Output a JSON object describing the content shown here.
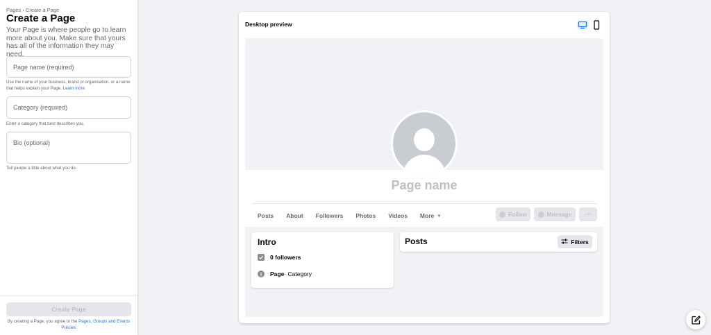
{
  "sidebar": {
    "breadcrumb": {
      "root": "Pages",
      "separator": "›",
      "current": "Create a Page"
    },
    "title": "Create a Page",
    "intro": "Your Page is where people go to learn more about you. Make sure that yours has all of the information they may need.",
    "fields": {
      "name": {
        "placeholder": "Page name (required)",
        "help": "Use the name of your business, brand or organisation, or a name that helps explain your Page.",
        "help_link": "Learn more"
      },
      "category": {
        "placeholder": "Category (required)",
        "help": "Enter a category that best describes you."
      },
      "bio": {
        "placeholder": "Bio (optional)",
        "help": "Tell people a little about what you do."
      }
    },
    "footer": {
      "create_label": "Create Page",
      "terms_prefix": "By creating a Page, you agree to the",
      "terms_link": "Pages, Groups and Events Policies"
    }
  },
  "preview": {
    "title": "Desktop preview",
    "page_name": "Page name",
    "tabs": [
      {
        "label": "Posts"
      },
      {
        "label": "About"
      },
      {
        "label": "Followers"
      },
      {
        "label": "Photos"
      },
      {
        "label": "Videos"
      },
      {
        "label": "More"
      }
    ],
    "actions": {
      "follow": "Follow",
      "message": "Message",
      "more": "···"
    },
    "intro": {
      "title": "Intro",
      "followers": "0 followers",
      "info_bold": "Page",
      "info_rest": " · Category"
    },
    "posts": {
      "title": "Posts",
      "filters": "Filters"
    }
  },
  "colors": {
    "link": "#216fdb",
    "background": "#f0f2f5",
    "disabled_button": "#e4e6eb",
    "disabled_text": "#bcc0c4"
  },
  "icons": [
    "desktop-icon",
    "mobile-icon",
    "avatar-placeholder-icon",
    "followers-check-icon",
    "info-icon",
    "filters-icon",
    "compose-icon",
    "caret-down-icon"
  ]
}
